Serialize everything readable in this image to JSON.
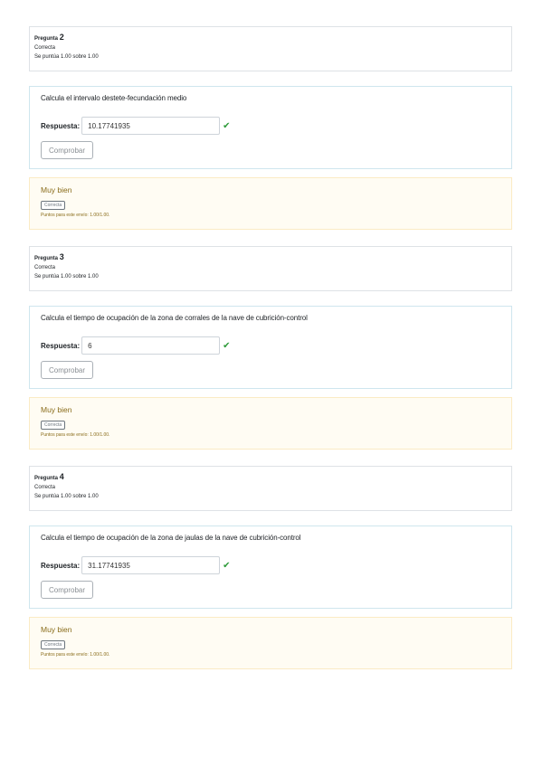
{
  "questions": [
    {
      "prefix": "Pregunta",
      "number": "2",
      "state": "Correcta",
      "grade": "Se puntúa 1.00 sobre 1.00",
      "text": "Calcula el intervalo destete-fecundación medio",
      "answer_label": "Respuesta:",
      "answer_value": "10.17741935",
      "check_label": "Comprobar",
      "feedback_title": "Muy bien",
      "feedback_badge": "Correcta",
      "feedback_points": "Puntos para este envío: 1.00/1.00."
    },
    {
      "prefix": "Pregunta",
      "number": "3",
      "state": "Correcta",
      "grade": "Se puntúa 1.00 sobre 1.00",
      "text": "Calcula el tiempo de ocupación de la zona de corrales de la nave de cubrición-control",
      "answer_label": "Respuesta:",
      "answer_value": "6",
      "check_label": "Comprobar",
      "feedback_title": "Muy bien",
      "feedback_badge": "Correcta",
      "feedback_points": "Puntos para este envío: 1.00/1.00."
    },
    {
      "prefix": "Pregunta",
      "number": "4",
      "state": "Correcta",
      "grade": "Se puntúa 1.00 sobre 1.00",
      "text": "Calcula el tiempo de ocupación de la zona de jaulas de la nave de cubrición-control",
      "answer_label": "Respuesta:",
      "answer_value": "31.17741935",
      "check_label": "Comprobar",
      "feedback_title": "Muy bien",
      "feedback_badge": "Correcta",
      "feedback_points": "Puntos para este envío: 1.00/1.00."
    }
  ],
  "icons": {
    "answer_status": "check-icon"
  },
  "colors": {
    "correct": "#2e9b3a",
    "feedback_text": "#8a6d1b",
    "feedback_bg": "#fffcf3"
  }
}
